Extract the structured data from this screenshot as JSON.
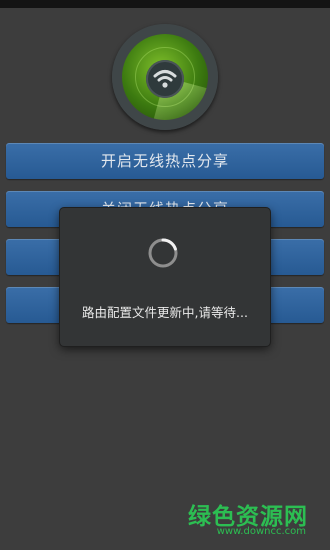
{
  "buttons": [
    {
      "label": "开启无线热点分享"
    },
    {
      "label": "关闭无线热点分享"
    },
    {
      "label": ""
    },
    {
      "label": ""
    }
  ],
  "dialog": {
    "message": "路由配置文件更新中,请等待..."
  },
  "watermark": {
    "title": "绿色资源网",
    "url": "www.downcc.com"
  },
  "icons": {
    "radar": "radar-wifi-icon",
    "spinner": "loading-spinner-icon"
  },
  "colors": {
    "background": "#3d3d3d",
    "button": "#2f639d",
    "dialog": "#333536",
    "watermark": "#2cbe52",
    "radar": "#5f9e1e"
  }
}
